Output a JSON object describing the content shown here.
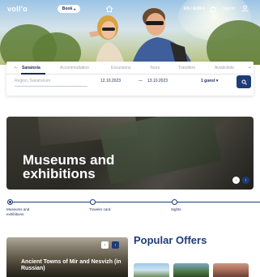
{
  "header": {
    "logo": "voll'o",
    "book_label": "Book",
    "lang_currency": "EN / EUR",
    "signin_label": "Sign in"
  },
  "search": {
    "tabs": [
      {
        "label": "Sanatoria",
        "active": true
      },
      {
        "label": "Accommodation",
        "active": false
      },
      {
        "label": "Excursions",
        "active": false
      },
      {
        "label": "Tours",
        "active": false
      },
      {
        "label": "Transfers",
        "active": false
      },
      {
        "label": "Aviatickets",
        "active": false
      }
    ],
    "region_placeholder": "Region, Sanatorium",
    "date_from": "12.10.2023",
    "date_separator": "—",
    "date_to": "13.10.2023",
    "guests": "1 guest"
  },
  "banner": {
    "title": "Museums and exhibitions"
  },
  "timeline": {
    "items": [
      {
        "label": "Museums and exhibitions",
        "active": true
      },
      {
        "label": "Traveler card",
        "active": false
      },
      {
        "label": "Sights",
        "active": false
      }
    ]
  },
  "tour_card": {
    "title": "Ancient Towns of Mir and Nesvizh (in Russian)"
  },
  "offers": {
    "heading": "Popular Offers"
  },
  "colors": {
    "brand_navy": "#1d3c78",
    "text_navy": "#1d2a55"
  }
}
